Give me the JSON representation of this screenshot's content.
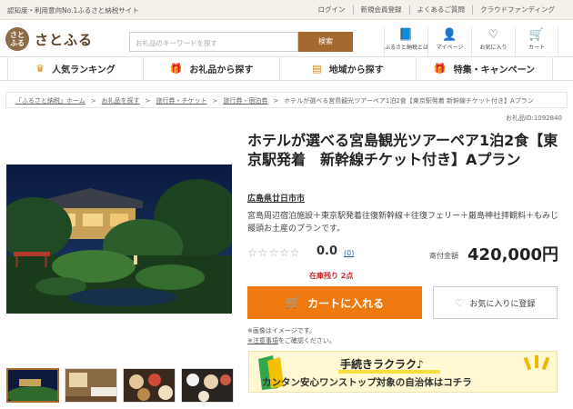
{
  "topbar": {
    "tagline": "認知度・利用意向No.1ふるさと納税サイト",
    "links": [
      "ログイン",
      "新規会員登録",
      "よくあるご質問",
      "クラウドファンディング"
    ]
  },
  "header": {
    "logo_mark": "さと ふる",
    "logo_text": "さとふる",
    "search_placeholder": "お礼品のキーワードを探す",
    "search_button": "検索",
    "icons": [
      {
        "icon": "book-icon",
        "glyph": "📘",
        "label": "ふるさと納税とは"
      },
      {
        "icon": "user-icon",
        "glyph": "👤",
        "label": "マイページ"
      },
      {
        "icon": "heart-icon",
        "glyph": "♡",
        "label": "お気に入り"
      },
      {
        "icon": "cart-icon",
        "glyph": "🛒",
        "label": "カート"
      }
    ]
  },
  "nav": [
    {
      "icon": "crown-icon",
      "glyph": "♛",
      "label": "人気ランキング"
    },
    {
      "icon": "gift-icon",
      "glyph": "🎁",
      "label": "お礼品から探す"
    },
    {
      "icon": "map-icon",
      "glyph": "▤",
      "label": "地域から探す"
    },
    {
      "icon": "gift-icon",
      "glyph": "🎁",
      "label": "特集・キャンペーン"
    }
  ],
  "breadcrumb": [
    "「ふるさと納税」ホーム",
    "お礼品を探す",
    "旅行券・チケット",
    "旅行券・宿泊券",
    "ホテルが選べる宮島観光ツアーペア1泊2食【東京駅発着 新幹線チケット付き】Aプラン"
  ],
  "item_id": "お礼品ID:1092840",
  "product": {
    "title": "ホテルが選べる宮島観光ツアーペア1泊2食【東京駅発着　新幹線チケット付き】Aプラン",
    "region": "広島県廿日市市",
    "description": "宮島周辺宿泊施設＋東京駅発着往復新幹線＋往復フェリー＋厳島神社拝観料＋もみじ饅頭お土産のプランです。",
    "stars": "☆☆☆☆☆",
    "rating": "0.0",
    "review_count": "(0)",
    "price_label": "寄付金額",
    "price": "420,000円",
    "stock": "在庫残り 2点",
    "cart_button": "カートに入れる",
    "favorite_button": "お気に入りに登録",
    "note1": "※画像はイメージです。",
    "note2_link": "※注意事項",
    "note2_rest": "をご確認ください。"
  },
  "banner": {
    "line1": "手続きラクラク♪",
    "line2": "カンタン安心ワンストップ対象の自治体はコチラ"
  },
  "colors": {
    "brand": "#a4692f",
    "cart": "#f07a12",
    "stock": "#c8282b",
    "banner": "#fff8d2"
  }
}
